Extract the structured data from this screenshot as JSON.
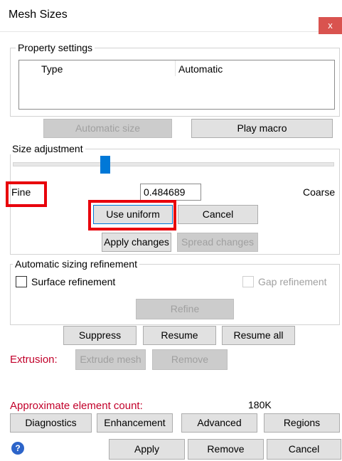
{
  "window": {
    "title": "Mesh Sizes",
    "close_glyph": "x"
  },
  "property_settings": {
    "legend": "Property settings",
    "columns": [
      "Type",
      "Automatic"
    ]
  },
  "buttons": {
    "automatic_size": "Automatic size",
    "play_macro": "Play macro",
    "use_uniform": "Use uniform",
    "cancel": "Cancel",
    "apply_changes": "Apply changes",
    "spread_changes": "Spread changes",
    "refine": "Refine",
    "suppress": "Suppress",
    "resume": "Resume",
    "resume_all": "Resume all",
    "extrude_mesh": "Extrude mesh",
    "remove_extrusion": "Remove",
    "diagnostics": "Diagnostics",
    "enhancement": "Enhancement",
    "advanced": "Advanced",
    "regions": "Regions",
    "apply": "Apply",
    "remove": "Remove",
    "cancel_bottom": "Cancel"
  },
  "size_adjustment": {
    "legend": "Size adjustment",
    "fine_label": "Fine",
    "coarse_label": "Coarse",
    "value": "0.484689",
    "slider_position_fraction": 0.29
  },
  "automatic_sizing_refinement": {
    "legend": "Automatic sizing refinement",
    "surface_refinement": "Surface refinement",
    "gap_refinement": "Gap refinement"
  },
  "extrusion": {
    "label": "Extrusion:"
  },
  "element_count": {
    "label": "Approximate element count:",
    "value": "180K"
  },
  "colors": {
    "accent": "#0078d7",
    "highlight_red": "#e8000b",
    "label_red": "#c2002a"
  },
  "icons": {
    "help": "help-icon"
  }
}
